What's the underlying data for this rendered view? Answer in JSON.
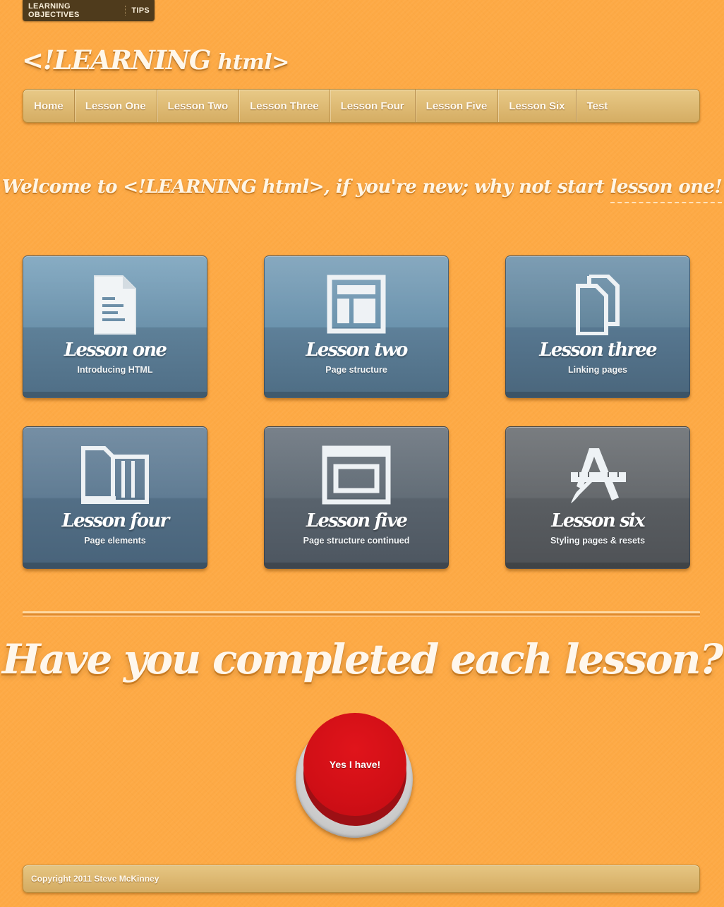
{
  "top_links": [
    "LEARNING OBJECTIVES",
    "TIPS"
  ],
  "logo": {
    "main": "<!LEARNING",
    "small": " html>"
  },
  "nav": [
    "Home",
    "Lesson One",
    "Lesson Two",
    "Lesson Three",
    "Lesson Four",
    "Lesson Five",
    "Lesson Six",
    "Test"
  ],
  "welcome": {
    "prefix": "Welcome to <!LEARNING html>, if you're new; why not start ",
    "link": "lesson one!"
  },
  "lessons": [
    {
      "title": "Lesson one",
      "subtitle": "Introducing HTML",
      "icon": "document-icon"
    },
    {
      "title": "Lesson two",
      "subtitle": "Page structure",
      "icon": "layout-icon"
    },
    {
      "title": "Lesson three",
      "subtitle": "Linking pages",
      "icon": "linked-documents-icon"
    },
    {
      "title": "Lesson four",
      "subtitle": "Page elements",
      "icon": "page-elements-icon"
    },
    {
      "title": "Lesson five",
      "subtitle": "Page structure continued",
      "icon": "browser-window-icon"
    },
    {
      "title": "Lesson six",
      "subtitle": "Styling pages & resets",
      "icon": "design-tools-icon"
    }
  ],
  "question": "Have you completed each lesson?",
  "button_label": "Yes I have!",
  "footer": "Copyright 2011 Steve McKinney",
  "colors": {
    "background": "#fda944",
    "button_red": "#d10f16",
    "nav_gold": "#dcb46c"
  }
}
